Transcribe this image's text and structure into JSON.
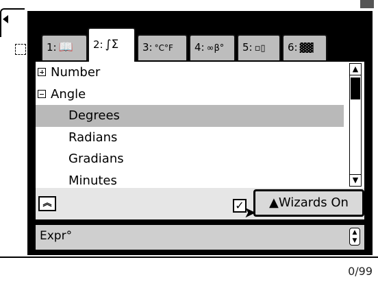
{
  "document": {
    "counter": "0/99"
  },
  "catalog": {
    "tabs": [
      {
        "number": "1:",
        "icon": "book-icon",
        "glyph": "📖"
      },
      {
        "number": "2:",
        "icon": "integral-sigma-icon",
        "glyph": "∫Σ"
      },
      {
        "number": "3:",
        "icon": "unit-conversion-icon",
        "glyph": "°C°F"
      },
      {
        "number": "4:",
        "icon": "infinity-beta-icon",
        "glyph": "∞β°"
      },
      {
        "number": "5:",
        "icon": "templates-icon",
        "glyph": "▫▯"
      },
      {
        "number": "6:",
        "icon": "library-icon",
        "glyph": "▓▓"
      }
    ],
    "active_tab": 1,
    "items": [
      {
        "label": "Number",
        "expander": "+"
      },
      {
        "label": "Angle",
        "expander": "-"
      },
      {
        "label": "Degrees",
        "selected": true
      },
      {
        "label": "Radians"
      },
      {
        "label": "Gradians"
      },
      {
        "label": "Minutes"
      }
    ],
    "wizards_label": "▲Wizards On",
    "wizards_checked": true,
    "footer_label": "Expr°"
  }
}
